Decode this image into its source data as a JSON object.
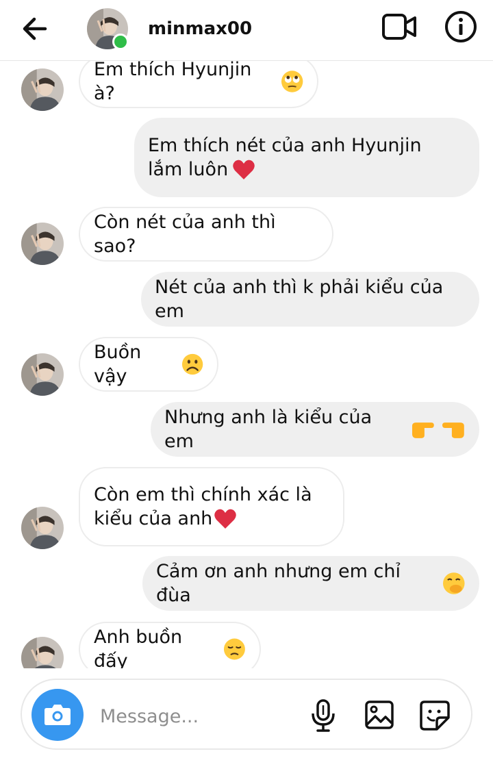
{
  "header": {
    "username": "minmax00",
    "back_icon": "arrow-left-icon",
    "video_icon": "video-camera-icon",
    "info_icon": "info-circle-icon",
    "online_color": "#2fbd48"
  },
  "messages": [
    {
      "side": "received",
      "text": "Em thích Hyunjin à?",
      "emoji": "face-with-rolling-eyes"
    },
    {
      "side": "sent",
      "text": "Em thích nét của anh Hyunjin\nlắm luôn",
      "emoji": "red-heart"
    },
    {
      "side": "received",
      "text": "Còn nét của anh thì sao?",
      "emoji": ""
    },
    {
      "side": "sent",
      "text": "Nét của anh thì k phải kiểu của em",
      "emoji": ""
    },
    {
      "side": "received",
      "text": "Buồn vậy",
      "emoji": "frowning-face"
    },
    {
      "side": "sent",
      "text": "Nhưng anh là kiểu của em",
      "emoji": "pointing-right pointing-left"
    },
    {
      "side": "received",
      "text": "Còn em thì chính xác là\nkiểu của anh",
      "emoji": "red-heart"
    },
    {
      "side": "sent",
      "text": "Cảm ơn anh nhưng em chỉ đùa",
      "emoji": "face-with-hand-over-mouth"
    },
    {
      "side": "received",
      "text": "Anh buồn đấy",
      "emoji": "pensive-face"
    }
  ],
  "composer": {
    "placeholder": "Message...",
    "camera_icon": "camera-icon",
    "mic_icon": "microphone-icon",
    "gallery_icon": "image-gallery-icon",
    "sticker_icon": "sticker-icon",
    "accent": "#3797f0"
  }
}
